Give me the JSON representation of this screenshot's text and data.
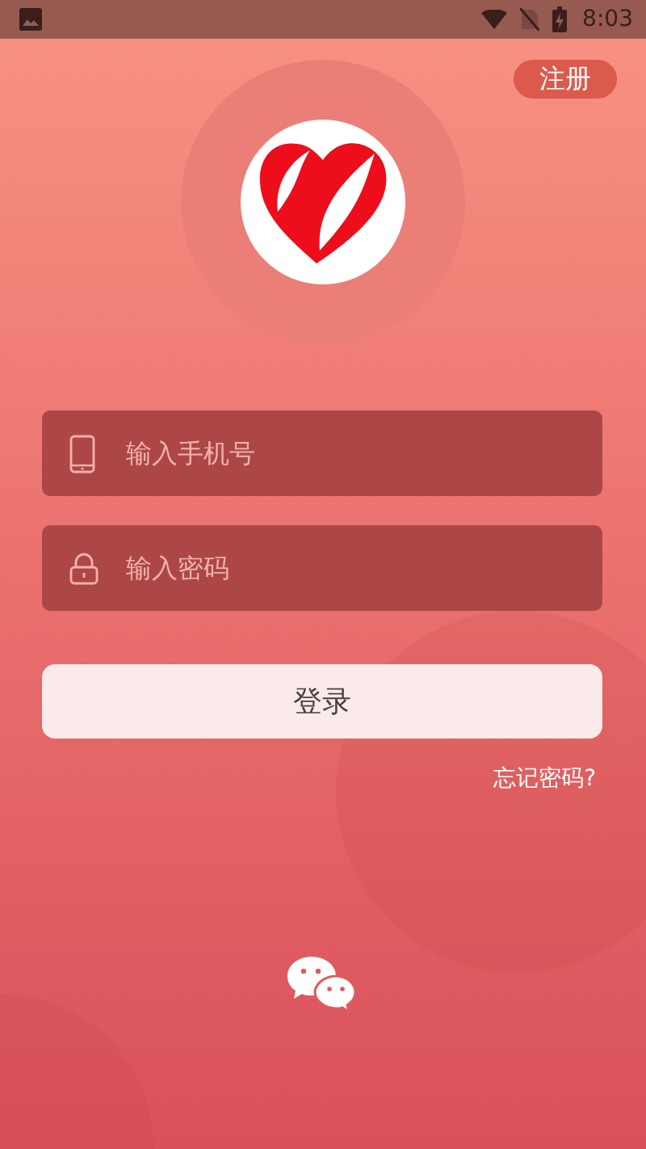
{
  "status_bar": {
    "time": "8:03"
  },
  "register_button": "注册",
  "fields": [
    {
      "kind": "phone",
      "placeholder": "输入手机号"
    },
    {
      "kind": "password",
      "placeholder": "输入密码"
    }
  ],
  "login_button": "登录",
  "forgot_password": "忘记密码?"
}
